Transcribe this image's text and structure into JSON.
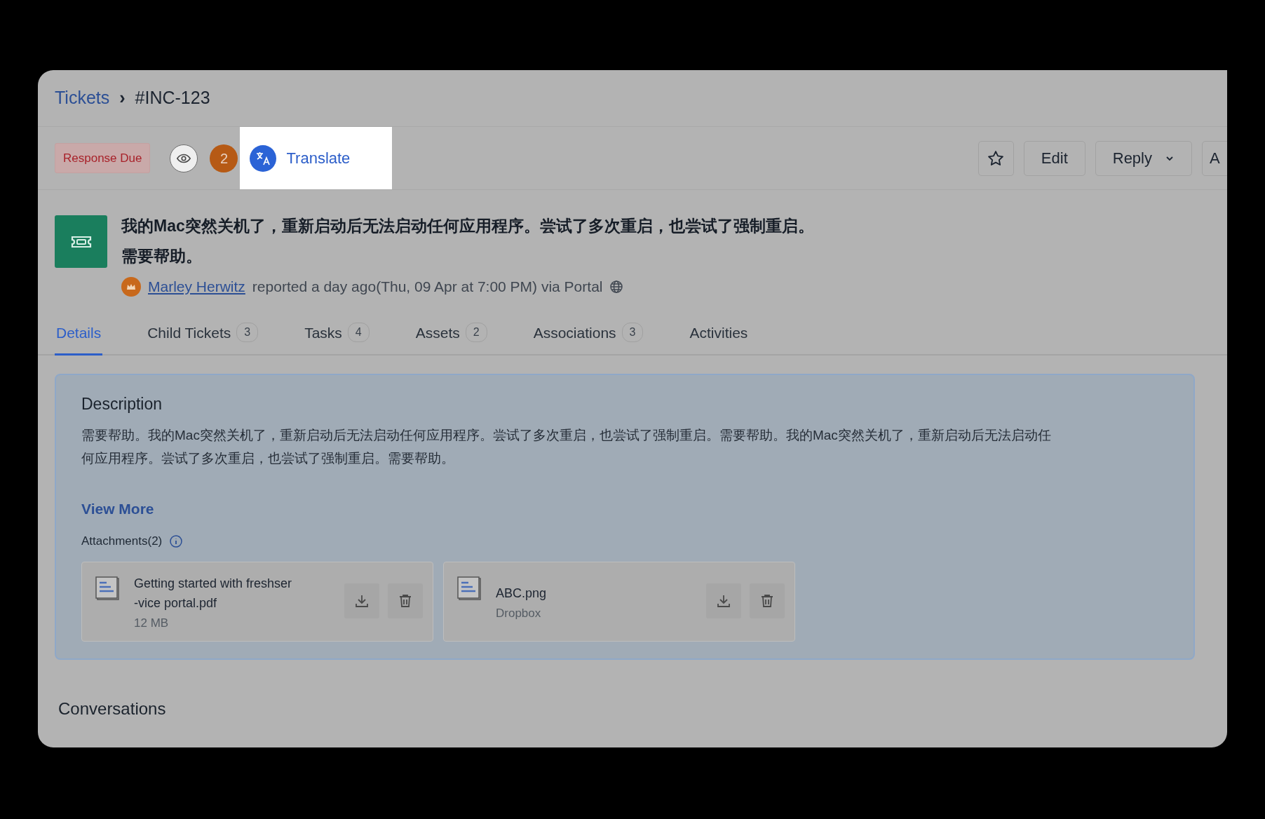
{
  "breadcrumb": {
    "parent": "Tickets",
    "separator": "›",
    "current": "#INC-123"
  },
  "toolbar": {
    "status_badge": "Response Due",
    "count_badge": "2",
    "translate": {
      "label": "Translate",
      "highlighted": true
    },
    "buttons": [
      {
        "kind": "star"
      },
      {
        "kind": "text",
        "label": "Edit"
      },
      {
        "kind": "dropdown",
        "label": "Reply"
      },
      {
        "kind": "text",
        "label": "A"
      }
    ]
  },
  "ticket": {
    "title": "我的Mac突然关机了，重新启动后无法启动任何应用程序。尝试了多次重启，也尝试了强制重启。需要帮助。",
    "requester": "Marley Herwitz",
    "meta": "reported a day ago(Thu, 09 Apr at 7:00 PM) via Portal"
  },
  "tabs": [
    {
      "label": "Details",
      "selected": true
    },
    {
      "label": "Child Tickets",
      "count": "3",
      "selected": false
    },
    {
      "label": "Tasks",
      "count": "4",
      "selected": false
    },
    {
      "label": "Assets",
      "count": "2",
      "selected": false
    },
    {
      "label": "Associations",
      "count": "3",
      "selected": false
    },
    {
      "label": "Activities",
      "selected": false
    }
  ],
  "description": {
    "title": "Description",
    "text": "需要帮助。我的Mac突然关机了，重新启动后无法启动任何应用程序。尝试了多次重启，也尝试了强制重启。需要帮助。我的Mac突然关机了，重新启动后无法启动任何应用程序。尝试了多次重启，也尝试了强制重启。需要帮助。",
    "view_more": "View More"
  },
  "attachments": {
    "title": "Attachments(2)",
    "items": [
      {
        "name_lines": [
          "Getting started with freshser",
          "-vice portal.pdf"
        ],
        "detail": "12 MB"
      },
      {
        "name_lines": [
          "ABC.png"
        ],
        "detail": "Dropbox"
      }
    ]
  },
  "conversations_title": "Conversations"
}
